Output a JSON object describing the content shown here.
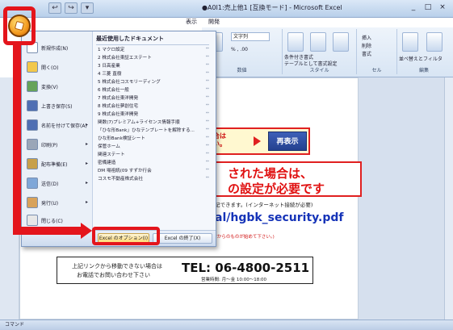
{
  "window": {
    "title": "●A0I1:売上他1 [互換モード] - Microsoft Excel",
    "qat_items": [
      "↩",
      "↪",
      "▾"
    ],
    "controls": [
      "_",
      "□",
      "×"
    ]
  },
  "ribbon": {
    "tabs": [
      "表示",
      "開発"
    ],
    "number_format": "文字列",
    "group_labels": [
      "数値",
      "スタイル",
      "セル",
      "編集"
    ],
    "style_buttons": [
      "条件付き書式",
      "テーブルとして書式設定",
      "セルのスタイル"
    ],
    "cell_buttons": [
      "挿入",
      "削除",
      "書式"
    ],
    "edit_buttons": [
      "並べ替えとフィルタ",
      "検索と選択"
    ]
  },
  "office_menu": {
    "items": [
      {
        "label": "新規作成(N)",
        "arrow": "",
        "color": "#ffffff"
      },
      {
        "label": "開く(O)",
        "arrow": "",
        "color": "#f2c84b"
      },
      {
        "label": "変換(V)",
        "arrow": "",
        "color": "#66a35a"
      },
      {
        "label": "上書き保存(S)",
        "arrow": "",
        "color": "#4f6fb3"
      },
      {
        "label": "名前を付けて保存(A)",
        "arrow": "▸",
        "color": "#4f6fb3"
      },
      {
        "label": "印刷(P)",
        "arrow": "▸",
        "color": "#9aa6b8"
      },
      {
        "label": "配布準備(E)",
        "arrow": "▸",
        "color": "#c7a04a"
      },
      {
        "label": "送信(D)",
        "arrow": "▸",
        "color": "#7fa7d8"
      },
      {
        "label": "発行(U)",
        "arrow": "▸",
        "color": "#d8a25a"
      },
      {
        "label": "閉じる(C)",
        "arrow": "",
        "color": "#e7e7e7"
      }
    ],
    "recent_header": "最近使用したドキュメント",
    "recent": [
      "1 マクロ設定",
      "2 株式会社東証エステート",
      "3 日高産業",
      "4 三菱 直樹",
      "5 株式会社コスモリーディング",
      "6 株式会社一般",
      "7 株式会社東洋開発",
      "8 株式会社夢創住宅",
      "9 株式会社東洋開発",
      "関数(7)プレミアム+ライセンス情報手順",
      "「ひな形Bank」ひなテンプレートを解除する...",
      "ひな形Bank検証シート",
      "保管ホーム",
      "関連ステート",
      "密備建造",
      "DM 場祖統(09 すずか行会",
      "コスモ不動産株式会社"
    ],
    "options_button": "Excel のオプション(I)",
    "exit_button": "Excel の終了(X)"
  },
  "document": {
    "warn_text": "場合は\nさい。",
    "redisplay_button": "再表示",
    "headline_1": "された場合は、",
    "headline_2": "の設定が必要です",
    "note": "記できます。(インターネット接続が必要)",
    "pdf_link": "al/hgbk_security.pdf",
    "red_note": "付録できる方からのものが始めて下さい。)",
    "contact_line1": "上記リンクから移動できない場合は",
    "contact_line2": "お電話でお問い合わせ下さい",
    "tel": "TEL: 06-4800-2511",
    "hours": "営業時間: 月～金 10:00～18:00"
  },
  "status": {
    "text": "コマンド"
  }
}
